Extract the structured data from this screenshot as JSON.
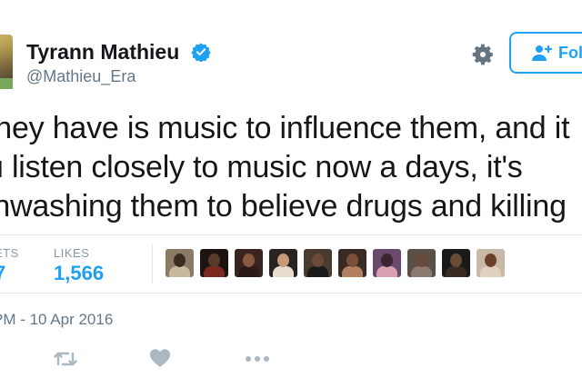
{
  "profile": {
    "display_name": "Tyrann Mathieu",
    "handle": "@Mathieu_Era",
    "verified_icon": "verified-badge-icon"
  },
  "header": {
    "settings_icon": "gear-icon",
    "follow_label": "Fol"
  },
  "tweet": {
    "lines": [
      "they have is music to influence them, and it",
      "u listen closely to music now a days, it's",
      "inwashing them to believe drugs and killing"
    ]
  },
  "stats": {
    "retweets_label": "ETS",
    "retweets_value": "7",
    "likes_label": "LIKES",
    "likes_value": "1,566"
  },
  "likers": [
    {
      "name": "liker-1",
      "bg": "#8b7a66",
      "head": "#3b2a20",
      "body": "#c9b8a0"
    },
    {
      "name": "liker-2",
      "bg": "#1b1410",
      "head": "#5a3a2a",
      "body": "#7a2a20"
    },
    {
      "name": "liker-3",
      "bg": "#3a2420",
      "head": "#8a5a40",
      "body": "#2a1a18"
    },
    {
      "name": "liker-4",
      "bg": "#2a2220",
      "head": "#c89a78",
      "body": "#e8dcd0"
    },
    {
      "name": "liker-5",
      "bg": "#4a3a30",
      "head": "#6a4a38",
      "body": "#1a1a1a"
    },
    {
      "name": "liker-6",
      "bg": "#3a2a26",
      "head": "#7a5038",
      "body": "#b08060"
    },
    {
      "name": "liker-7",
      "bg": "#6a4a6a",
      "head": "#3a2430",
      "body": "#d8a0b0"
    },
    {
      "name": "liker-8",
      "bg": "#5a5048",
      "head": "#6a4a3a",
      "body": "#8a7a70"
    },
    {
      "name": "liker-9",
      "bg": "#1a1a1a",
      "head": "#6a4a34",
      "body": "#3a2a24"
    },
    {
      "name": "liker-10",
      "bg": "#c8b8a8",
      "head": "#6a4028",
      "body": "#e0d0c0"
    }
  ],
  "meta": {
    "timestamp": "PM - 10 Apr 2016"
  },
  "actions": {
    "retweet_icon": "retweet-icon",
    "like_icon": "heart-icon",
    "more_icon": "more-dots-icon"
  },
  "colors": {
    "accent": "#1da1f2",
    "text": "#14171a",
    "muted": "#657786",
    "divider": "#e1e8ed",
    "action_icons": "#aab8c2"
  }
}
